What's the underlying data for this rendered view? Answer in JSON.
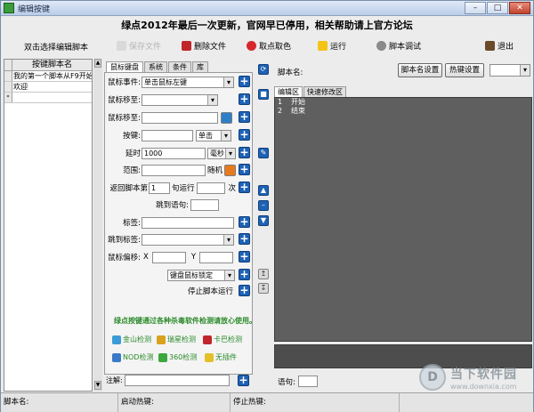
{
  "window": {
    "title": "编辑按键",
    "min_label": "–",
    "max_label": "□",
    "close_label": "✕"
  },
  "banner": "绿点2012年最后一次更新，官网早已停用，相关帮助请上官方论坛",
  "toolbar": {
    "left_label": "双击选择编辑脚本",
    "save": "保存文件",
    "delete": "删除文件",
    "pick_color": "取点取色",
    "run": "运行",
    "debug": "脚本调试",
    "exit": "退出"
  },
  "script_list": {
    "header": "按键脚本名",
    "rows": [
      {
        "marker": "",
        "name": "我的第一个脚本从F9开始"
      },
      {
        "marker": "",
        "name": "欢迎"
      },
      {
        "marker": "*",
        "name": ""
      }
    ]
  },
  "action_tabs": [
    "鼠标键盘",
    "系统",
    "条件",
    "库"
  ],
  "form": {
    "mouse_event_label": "鼠标事件:",
    "mouse_event_value": "单击鼠标左键",
    "mouse_move_to_label": "鼠标移至:",
    "mouse_move_to_value": "",
    "mouse_move_to2_label": "鼠标移至:",
    "key_label": "按键:",
    "key_mode": "单击",
    "delay_label": "延时",
    "delay_value": "1000",
    "delay_unit": "毫秒",
    "range_label": "范围:",
    "random_label": "随机",
    "return_label": "返回脚本第",
    "return_value": "1",
    "return_mid": "句运行",
    "return_unit": "次",
    "jump_label": "跳到语句:",
    "tag_label": "标签:",
    "jump_tag_label": "跳到标签:",
    "offset_label": "鼠标偏移:",
    "offset_x_label": "X",
    "offset_y_label": "Y",
    "lock_label": "键盘鼠标锁定",
    "stop_label": "停止脚本运行"
  },
  "antivirus": {
    "note": "绿点按键通过各种杀毒软件检测请放心使用。",
    "items": [
      "金山检测",
      "瑞星检测",
      "卡巴检测",
      "NOD检测",
      "360检测",
      "无插件"
    ]
  },
  "comment_label": "注解:",
  "right_panel": {
    "script_name_label": "脚本名:",
    "script_settings": "脚本名设置",
    "hotkey_settings": "热键设置",
    "tabs": [
      "编辑区",
      "快速修改区"
    ],
    "code_lines": [
      {
        "no": "1",
        "text": "开始"
      },
      {
        "no": "2",
        "text": "结束"
      }
    ],
    "statement_label": "语句:"
  },
  "status": {
    "script_name": "脚本名:",
    "start_hotkey": "启动热键:",
    "stop_hotkey": "停止热键:"
  },
  "watermark": {
    "logo": "D",
    "cn": "当下软件园",
    "en": "www.downxia.com"
  },
  "colors": {
    "accent_blue": "#1e62b5",
    "editor_bg": "#5f5f5f",
    "av_green": "#2a8a2a"
  }
}
